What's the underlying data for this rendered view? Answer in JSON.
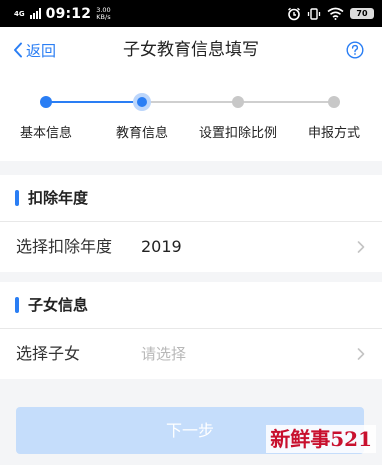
{
  "status_bar": {
    "network": "4G",
    "time": "09:12",
    "speed_value": "3.00",
    "speed_unit": "KB/s",
    "battery": "70",
    "icons": [
      "signal-icon",
      "alarm-icon",
      "vibrate-icon",
      "wifi-icon",
      "battery-icon"
    ]
  },
  "nav": {
    "back_label": "返回",
    "title": "子女教育信息填写",
    "help_icon": "help-icon"
  },
  "stepper": {
    "active_index": 1,
    "steps": [
      {
        "label": "基本信息",
        "state": "done"
      },
      {
        "label": "教育信息",
        "state": "current"
      },
      {
        "label": "设置扣除比例",
        "state": "pending"
      },
      {
        "label": "申报方式",
        "state": "pending"
      }
    ]
  },
  "sections": {
    "deduction_year": {
      "title": "扣除年度",
      "row_label": "选择扣除年度",
      "row_value": "2019"
    },
    "child_info": {
      "title": "子女信息",
      "row_label": "选择子女",
      "row_placeholder": "请选择"
    }
  },
  "next_button_label": "下一步",
  "watermark": "新鲜事521",
  "colors": {
    "accent": "#2a7ef4",
    "pending": "#c8c8c8",
    "button_disabled": "#c5ddfb"
  }
}
